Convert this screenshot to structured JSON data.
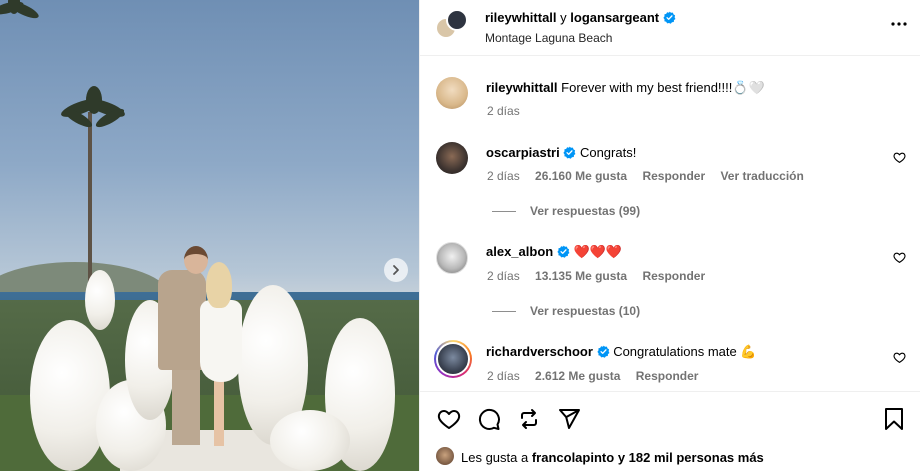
{
  "header": {
    "user1": "rileywhittall",
    "connector": "y",
    "user2": "logansargeant",
    "location": "Montage Laguna Beach"
  },
  "caption": {
    "username": "rileywhittall",
    "text": "Forever with my best friend!!!!",
    "emoji": "💍🤍",
    "time": "2 días"
  },
  "comments": [
    {
      "username": "oscarpiastri",
      "verified": true,
      "text": "Congrats!",
      "time": "2 días",
      "likes": "26.160 Me gusta",
      "reply_label": "Responder",
      "translate_label": "Ver traducción",
      "view_replies": "Ver respuestas (99)"
    },
    {
      "username": "alex_albon",
      "verified": true,
      "text": "❤️❤️❤️",
      "time": "2 días",
      "likes": "13.135 Me gusta",
      "reply_label": "Responder",
      "view_replies": "Ver respuestas (10)"
    },
    {
      "username": "richardverschoor",
      "verified": true,
      "text": "Congratulations mate 💪",
      "time": "2 días",
      "likes": "2.612 Me gusta",
      "reply_label": "Responder"
    }
  ],
  "likes_line": {
    "prefix": "Les gusta a",
    "user": "francolapinto",
    "suffix": "y 182 mil personas más"
  },
  "icons": {
    "more": "more-horizontal-icon",
    "like": "heart-icon",
    "comment": "comment-icon",
    "repost": "repost-icon",
    "share": "share-icon",
    "save": "bookmark-icon",
    "verified": "verified-badge-icon",
    "next": "chevron-right-icon"
  },
  "colors": {
    "verified": "#0095f6",
    "meta": "#737373",
    "story_ring": "#d6249f"
  }
}
